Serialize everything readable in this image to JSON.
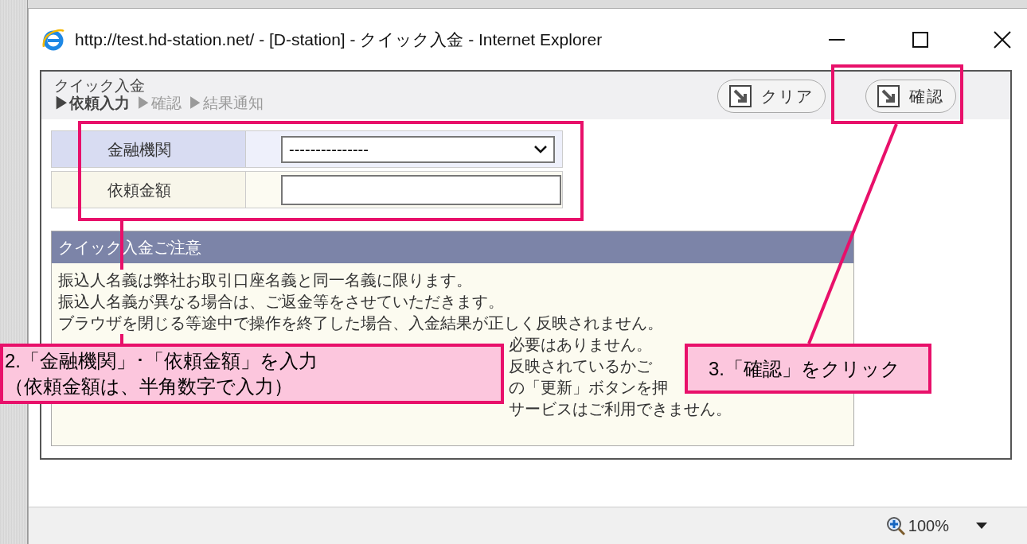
{
  "window": {
    "title": "http://test.hd-station.net/ - [D-station] - クイック入金 - Internet Explorer"
  },
  "page": {
    "title": "クイック入金",
    "steps": [
      {
        "label": "▶依頼入力",
        "selected": true
      },
      {
        "label": "▶確認",
        "selected": false
      },
      {
        "label": "▶結果通知",
        "selected": false
      }
    ],
    "buttons": [
      {
        "label": "クリア"
      },
      {
        "label": "確認"
      }
    ],
    "form": [
      {
        "label": "金融機関",
        "kind": "select",
        "value": "---------------"
      },
      {
        "label": "依頼金額",
        "kind": "text"
      }
    ],
    "notice": {
      "title": "クイック入金ご注意",
      "lines": [
        "振込人名義は弊社お取引口座名義と同一名義に限ります。",
        "振込人名義が異なる場合は、ご返金等をさせていただきます。",
        "ブラウザを閉じる等途中で操作を終了した場合、入金結果が正しく反映されません。"
      ],
      "fragments": [
        "必要はありません。",
        "反映されているかご",
        "の「更新」ボタンを押",
        "サービスはご利用できません。"
      ]
    }
  },
  "status_bar": {
    "zoom": "100%"
  },
  "annotations": [
    {
      "lines": [
        "2.「金融機関」･「依頼金額」を入力",
        "（依頼金額は、半角数字で入力）"
      ]
    },
    {
      "lines": [
        "3.「確認」をクリック"
      ]
    }
  ]
}
